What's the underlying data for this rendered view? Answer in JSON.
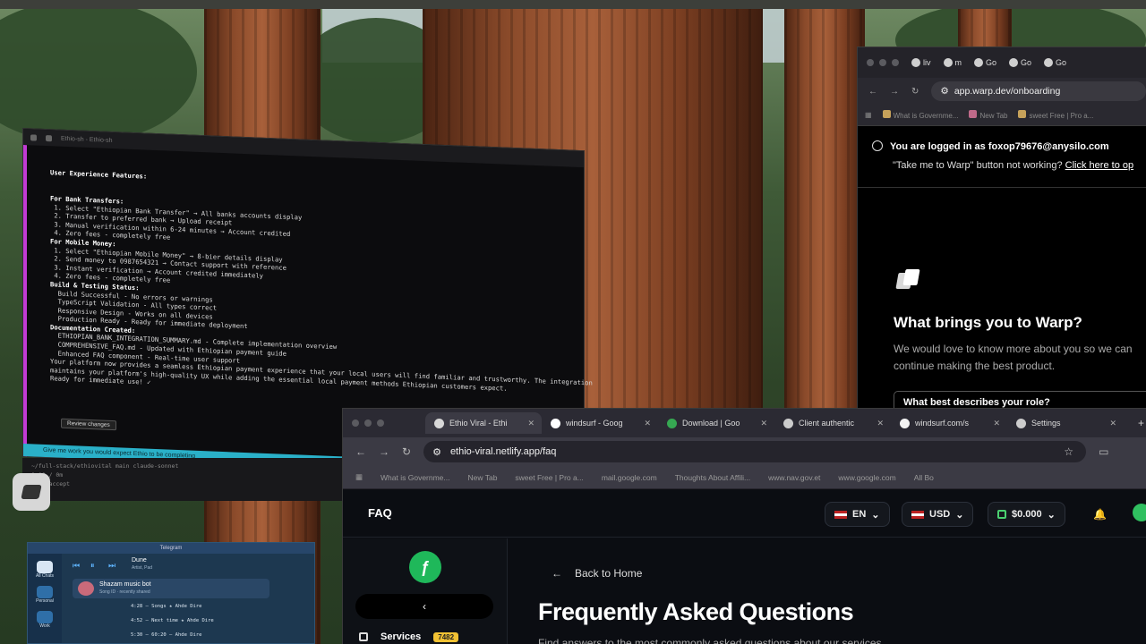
{
  "terminal": {
    "tab_text": "Ethio-sh - Ethio-sh",
    "header": "User Experience Features:",
    "lines": [
      "For Bank Transfers:",
      " 1. Select \"Ethiopian Bank Transfer\" → All banks accounts display",
      " 2. Transfer to preferred bank → Upload receipt",
      " 3. Manual verification within 6-24 minutes → Account credited",
      " 4. Zero fees - completely free",
      "",
      "For Mobile Money:",
      " 1. Select \"Ethiopian Mobile Money\" → 8-bier details display",
      " 2. Send money to 0987654321 → Contact support with reference",
      " 3. Instant verification → Account credited immediately",
      " 4. Zero fees - completely free",
      "",
      "Build & Testing Status:",
      "  Build Successful - No errors or warnings",
      "  TypeScript Validation - All types correct",
      "  Responsive Design - Works on all devices",
      "  Production Ready - Ready for immediate deployment",
      "",
      "Documentation Created:",
      "  ETHIOPIAN_BANK_INTEGRATION_SUMMARY.md - Complete implementation overview",
      "  COMPREHENSIVE_FAQ.md - Updated with Ethiopian payment guide",
      "  Enhanced FAQ component - Real-time user support",
      "",
      "Your platform now provides a seamless Ethiopian payment experience that your local users will find familiar and trustworthy. The integration",
      "maintains your platform's high-quality UX while adding the essential local payment methods Ethiopian customers expect.",
      "",
      "Ready for immediate use! ✓"
    ],
    "review_button": "Review changes",
    "input_hint": "Give me work you would expect Ethio to be completing",
    "status_line": "  ~/full-stack/ethiovital   main   claude-sonnet",
    "status_sub": "0:00 / 0m",
    "status_sub2": "Auto-accept"
  },
  "chat": {
    "window_title": "Telegram",
    "player_title": "Dune",
    "player_sub": "Artist, Pad",
    "bot_name": "Shazam music bot",
    "bot_sub": "Song ID · recently shared",
    "messages": [
      "4:28 — Songs ★ Ahde Dire",
      "4:52 — Next time ★ Ahde Dire",
      "5:30 — 60:20 — Ahde Dire"
    ],
    "sidebar_labels": [
      "All Chats",
      "Personal",
      "Work"
    ]
  },
  "warp": {
    "tabs": [
      "liv",
      "m",
      "Go",
      "Go",
      "Go"
    ],
    "url": "app.warp.dev/onboarding",
    "bookmarks": [
      "What is Governme...",
      "New Tab",
      "sweet Free | Pro a..."
    ],
    "logged_in": "You are logged in as foxop79676@anysilo.com",
    "take_me": "\"Take me to Warp\" button not working?",
    "click_here": "Click here to op",
    "heading": "What brings you to Warp?",
    "text": "We would love to know more about you so we can continue making the best product.",
    "select_label": "What best describes your role?"
  },
  "faq_browser": {
    "tabs": [
      {
        "label": "Ethio Viral - Ethi",
        "color": "#d8d8d8"
      },
      {
        "label": "windsurf - Goog",
        "color": "#ffffff"
      },
      {
        "label": "Download | Goo",
        "color": "#36a852"
      },
      {
        "label": "Client authentic",
        "color": "#cccccc"
      },
      {
        "label": "windsurf.com/s",
        "color": "#f3f3f3"
      },
      {
        "label": "Settings",
        "color": "#cccccc"
      }
    ],
    "url": "ethio-viral.netlify.app/faq",
    "bookmarks": [
      "What is Governme...",
      "New Tab",
      "sweet Free | Pro a...",
      "mail.google.com",
      "Thoughts About Affili...",
      "www.nav.gov.et",
      "www.google.com",
      "All Bo"
    ],
    "brand": "FAQ",
    "lang": "EN",
    "currency": "USD",
    "balance": "$0.000",
    "sidebar_logo": "ƒ",
    "collapse": "‹",
    "services_label": "Services",
    "services_badge": "7482",
    "back": "Back to Home",
    "title": "Frequently Asked Questions",
    "subtitle": "Find answers to the most commonly asked questions about our services"
  }
}
